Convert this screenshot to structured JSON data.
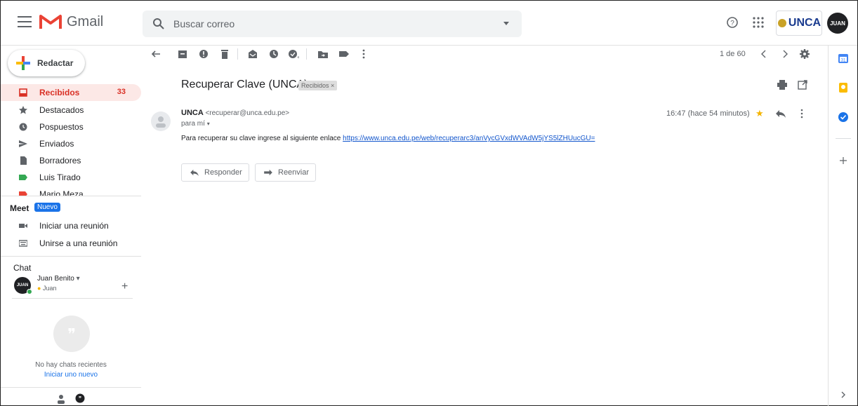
{
  "app": {
    "name": "Gmail"
  },
  "search": {
    "placeholder": "Buscar correo"
  },
  "compose": {
    "label": "Redactar"
  },
  "nav": [
    {
      "label": "Recibidos",
      "count": "33",
      "icon": "inbox-icon",
      "active": true
    },
    {
      "label": "Destacados",
      "icon": "star-icon"
    },
    {
      "label": "Pospuestos",
      "icon": "clock-icon"
    },
    {
      "label": "Enviados",
      "icon": "send-icon"
    },
    {
      "label": "Borradores",
      "icon": "draft-icon"
    },
    {
      "label": "Luis Tirado",
      "icon": "label-icon",
      "color": "#34a853"
    },
    {
      "label": "Mario Meza",
      "icon": "label-icon",
      "color": "#ea4335"
    }
  ],
  "meet": {
    "title": "Meet",
    "badge": "Nuevo",
    "items": [
      {
        "label": "Iniciar una reunión",
        "icon": "video-icon"
      },
      {
        "label": "Unirse a una reunión",
        "icon": "keyboard-icon"
      }
    ]
  },
  "chat": {
    "title": "Chat",
    "user_name": "Juan Benito",
    "user_status": "Juan",
    "avatar_text": "JUAN",
    "empty_text": "No hay chats recientes",
    "start_new": "Iniciar uno nuevo"
  },
  "header": {
    "org_logo": "UNCA",
    "avatar_text": "JUAN"
  },
  "toolbar": {
    "pager": "1 de 60"
  },
  "email": {
    "subject": "Recuperar Clave (UNCA)",
    "label_chip": "Recibidos ×",
    "sender_name": "UNCA",
    "sender_email": "<recuperar@unca.edu.pe>",
    "to": "para mí",
    "time": "16:47 (hace 54 minutos)",
    "body_text": "Para recuperar su clave ingrese al siguiente enlace ",
    "body_link": "https://www.unca.edu.pe/web/recuperarc3/anVycGVxdWVAdW5jYS5lZHUucGU="
  },
  "actions": {
    "reply_label": "Responder",
    "forward_label": "Reenviar"
  },
  "colors": {
    "gmail_red": "#ea4335",
    "accent_blue": "#1a73e8",
    "active_bg": "#fce8e6",
    "link": "#1155cc"
  }
}
